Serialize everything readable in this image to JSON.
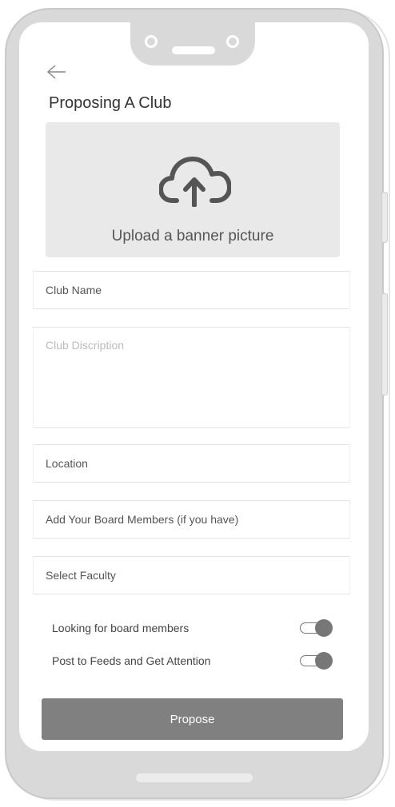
{
  "header": {
    "title": "Proposing A Club",
    "back_icon": "arrow-left-icon"
  },
  "upload": {
    "icon": "cloud-upload-icon",
    "label": "Upload a banner picture"
  },
  "form": {
    "club_name": "Club Name",
    "club_description_placeholder": "Club Discription",
    "location": "Location",
    "board_members": "Add Your Board Members (if you have)",
    "faculty": "Select Faculty"
  },
  "toggles": [
    {
      "label": "Looking for board members",
      "on": true
    },
    {
      "label": "Post to Feeds and Get Attention",
      "on": true
    }
  ],
  "actions": {
    "propose_label": "Propose"
  },
  "colors": {
    "button": "#808080",
    "upload_bg": "#e9e9e9",
    "frame": "#d9d9d9"
  }
}
